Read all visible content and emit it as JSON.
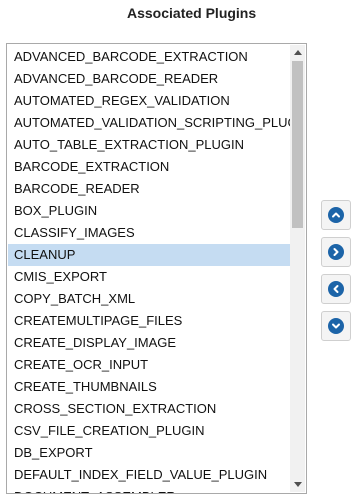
{
  "title": "Associated Plugins",
  "plugins": [
    "ADVANCED_BARCODE_EXTRACTION",
    "ADVANCED_BARCODE_READER",
    "AUTOMATED_REGEX_VALIDATION",
    "AUTOMATED_VALIDATION_SCRIPTING_PLUGIN",
    "AUTO_TABLE_EXTRACTION_PLUGIN",
    "BARCODE_EXTRACTION",
    "BARCODE_READER",
    "BOX_PLUGIN",
    "CLASSIFY_IMAGES",
    "CLEANUP",
    "CMIS_EXPORT",
    "COPY_BATCH_XML",
    "CREATEMULTIPAGE_FILES",
    "CREATE_DISPLAY_IMAGE",
    "CREATE_OCR_INPUT",
    "CREATE_THUMBNAILS",
    "CROSS_SECTION_EXTRACTION",
    "CSV_FILE_CREATION_PLUGIN",
    "DB_EXPORT",
    "DEFAULT_INDEX_FIELD_VALUE_PLUGIN",
    "DOCUMENT_ASSEMBLER"
  ],
  "selected_plugin": "CLEANUP",
  "icons": {
    "scroll_up": "triangle-up-icon",
    "scroll_down": "triangle-down-icon",
    "move_top": "chevron-up-circle-icon",
    "move_right": "chevron-right-circle-icon",
    "move_left": "chevron-left-circle-icon",
    "move_bottom": "chevron-down-circle-icon"
  },
  "colors": {
    "selected_row": "#c5dcf2",
    "button_icon": "#1c64a8",
    "scroll_thumb": "#c1c1c1"
  }
}
